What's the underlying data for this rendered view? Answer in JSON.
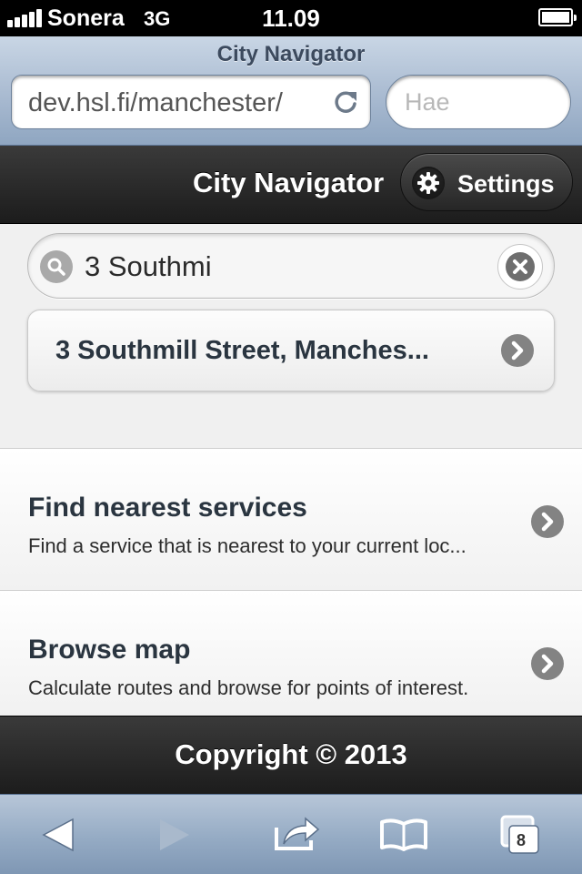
{
  "status_bar": {
    "carrier": "Sonera",
    "network": "3G",
    "time": "11.09"
  },
  "browser": {
    "page_title": "City Navigator",
    "url": "dev.hsl.fi/manchester/",
    "search_placeholder": "Hae",
    "tab_count": "8"
  },
  "header": {
    "title": "City Navigator",
    "settings_label": "Settings"
  },
  "search": {
    "value": "3 Southmi"
  },
  "suggestion": {
    "label": "3 Southmill Street, Manches..."
  },
  "menu": [
    {
      "title": "Find nearest services",
      "description": "Find a service that is nearest to your current loc..."
    },
    {
      "title": "Browse map",
      "description": "Calculate routes and browse for points of interest."
    }
  ],
  "footer": {
    "copyright": "Copyright © 2013"
  },
  "colors": {
    "header_bg": "#262626",
    "safari_chrome": "#a6b8cf",
    "content_bg": "#f0f0f0",
    "title_text": "#2a3540"
  },
  "icons": [
    "signal-icon",
    "battery-icon",
    "reload-icon",
    "gear-icon",
    "search-icon",
    "clear-icon",
    "chevron-right-icon",
    "back-icon",
    "forward-icon",
    "share-icon",
    "bookmarks-icon",
    "tabs-icon"
  ]
}
